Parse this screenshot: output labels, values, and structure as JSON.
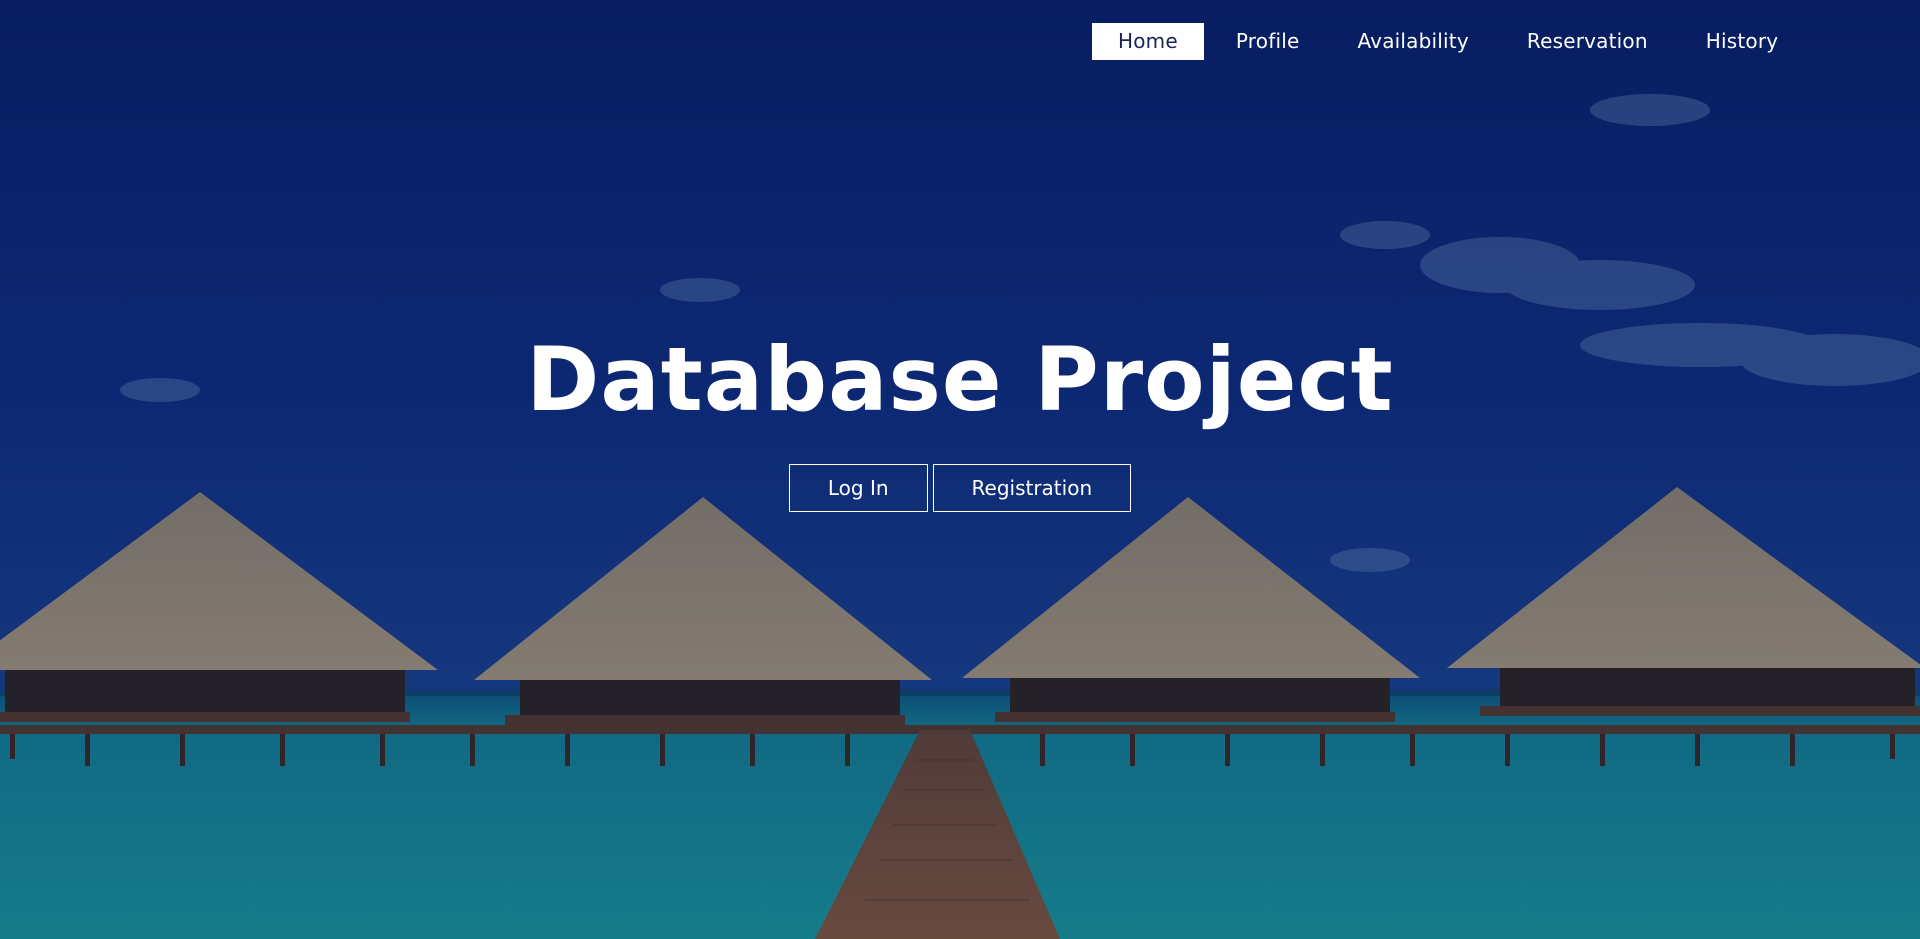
{
  "nav": {
    "items": [
      {
        "label": "Home",
        "active": true
      },
      {
        "label": "Profile",
        "active": false
      },
      {
        "label": "Availability",
        "active": false
      },
      {
        "label": "Reservation",
        "active": false
      },
      {
        "label": "History",
        "active": false
      }
    ]
  },
  "hero": {
    "title": "Database Project",
    "buttons": {
      "login": "Log In",
      "registration": "Registration"
    }
  },
  "colors": {
    "sky_top": "#0a2370",
    "sky_bottom": "#143c8c",
    "water": "#1aa3a8",
    "thatch": "#a99a7e",
    "dock": "#6a4630",
    "overlay": "#0b1740"
  }
}
